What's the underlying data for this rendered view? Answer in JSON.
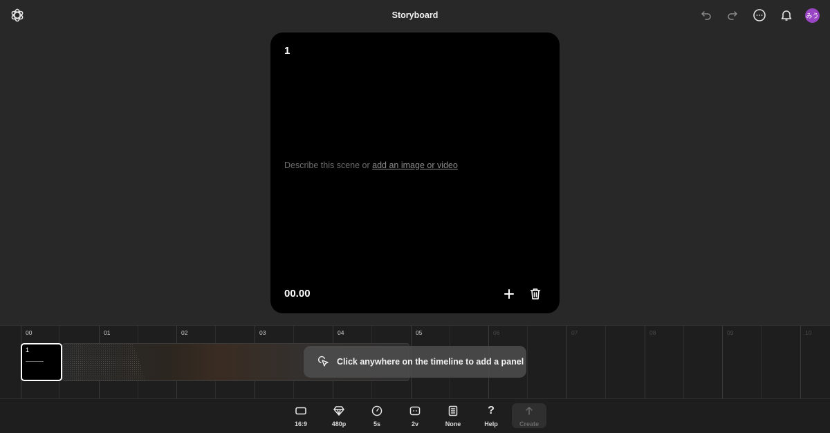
{
  "header": {
    "title": "Storyboard",
    "avatar_initials": "みう",
    "icons": [
      "openai-logo-icon",
      "undo-icon",
      "redo-icon",
      "more-icon",
      "bell-icon"
    ]
  },
  "scene": {
    "number": "1",
    "prompt_prefix": "Describe this scene or ",
    "prompt_link": "add an image or video",
    "timecode": "00.00"
  },
  "timeline": {
    "labels": [
      "00",
      "01",
      "02",
      "03",
      "04",
      "05",
      "06",
      "07",
      "08",
      "09",
      "10"
    ],
    "active_label_count": 6,
    "panel_number": "1",
    "hint": "Click anywhere on the timeline to add a panel"
  },
  "toolbar": {
    "items": [
      {
        "label": "16:9",
        "icon": "aspect-ratio-icon"
      },
      {
        "label": "480p",
        "icon": "diamond-icon"
      },
      {
        "label": "5s",
        "icon": "clock-icon"
      },
      {
        "label": "2v",
        "icon": "variations-icon"
      },
      {
        "label": "None",
        "icon": "preset-icon"
      },
      {
        "label": "Help",
        "icon": "question-icon"
      }
    ],
    "create_label": "Create"
  },
  "colors": {
    "background": "#282828",
    "card": "#000000",
    "avatar": "#9a46c4",
    "timeline": "#1e1e1e"
  }
}
